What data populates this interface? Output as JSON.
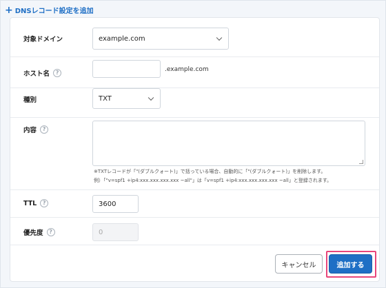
{
  "header": {
    "add_record_label": "DNSレコード設定を追加"
  },
  "form": {
    "target_domain": {
      "label": "対象ドメイン",
      "value": "example.com"
    },
    "hostname": {
      "label": "ホスト名",
      "value": "",
      "suffix": ".example.com"
    },
    "type": {
      "label": "種別",
      "value": "TXT"
    },
    "content": {
      "label": "内容",
      "value": "",
      "note_line1": "※TXTレコードが「\"(ダブルクォート)」で括っている場合、自動的に「\"(ダブルクォート)」を削除します。",
      "note_line2": "例）「\"v=spf1 +ip4:xxx.xxx.xxx.xxx ~all\"」は「v=spf1 +ip4:xxx.xxx.xxx.xxx ~all」と登録されます。"
    },
    "ttl": {
      "label": "TTL",
      "value": "3600"
    },
    "priority": {
      "label": "優先度",
      "value": "0"
    }
  },
  "buttons": {
    "cancel_label": "キャンセル",
    "add_label": "追加する"
  },
  "colors": {
    "accent": "#1f6fc5",
    "highlight": "#e8457a"
  }
}
